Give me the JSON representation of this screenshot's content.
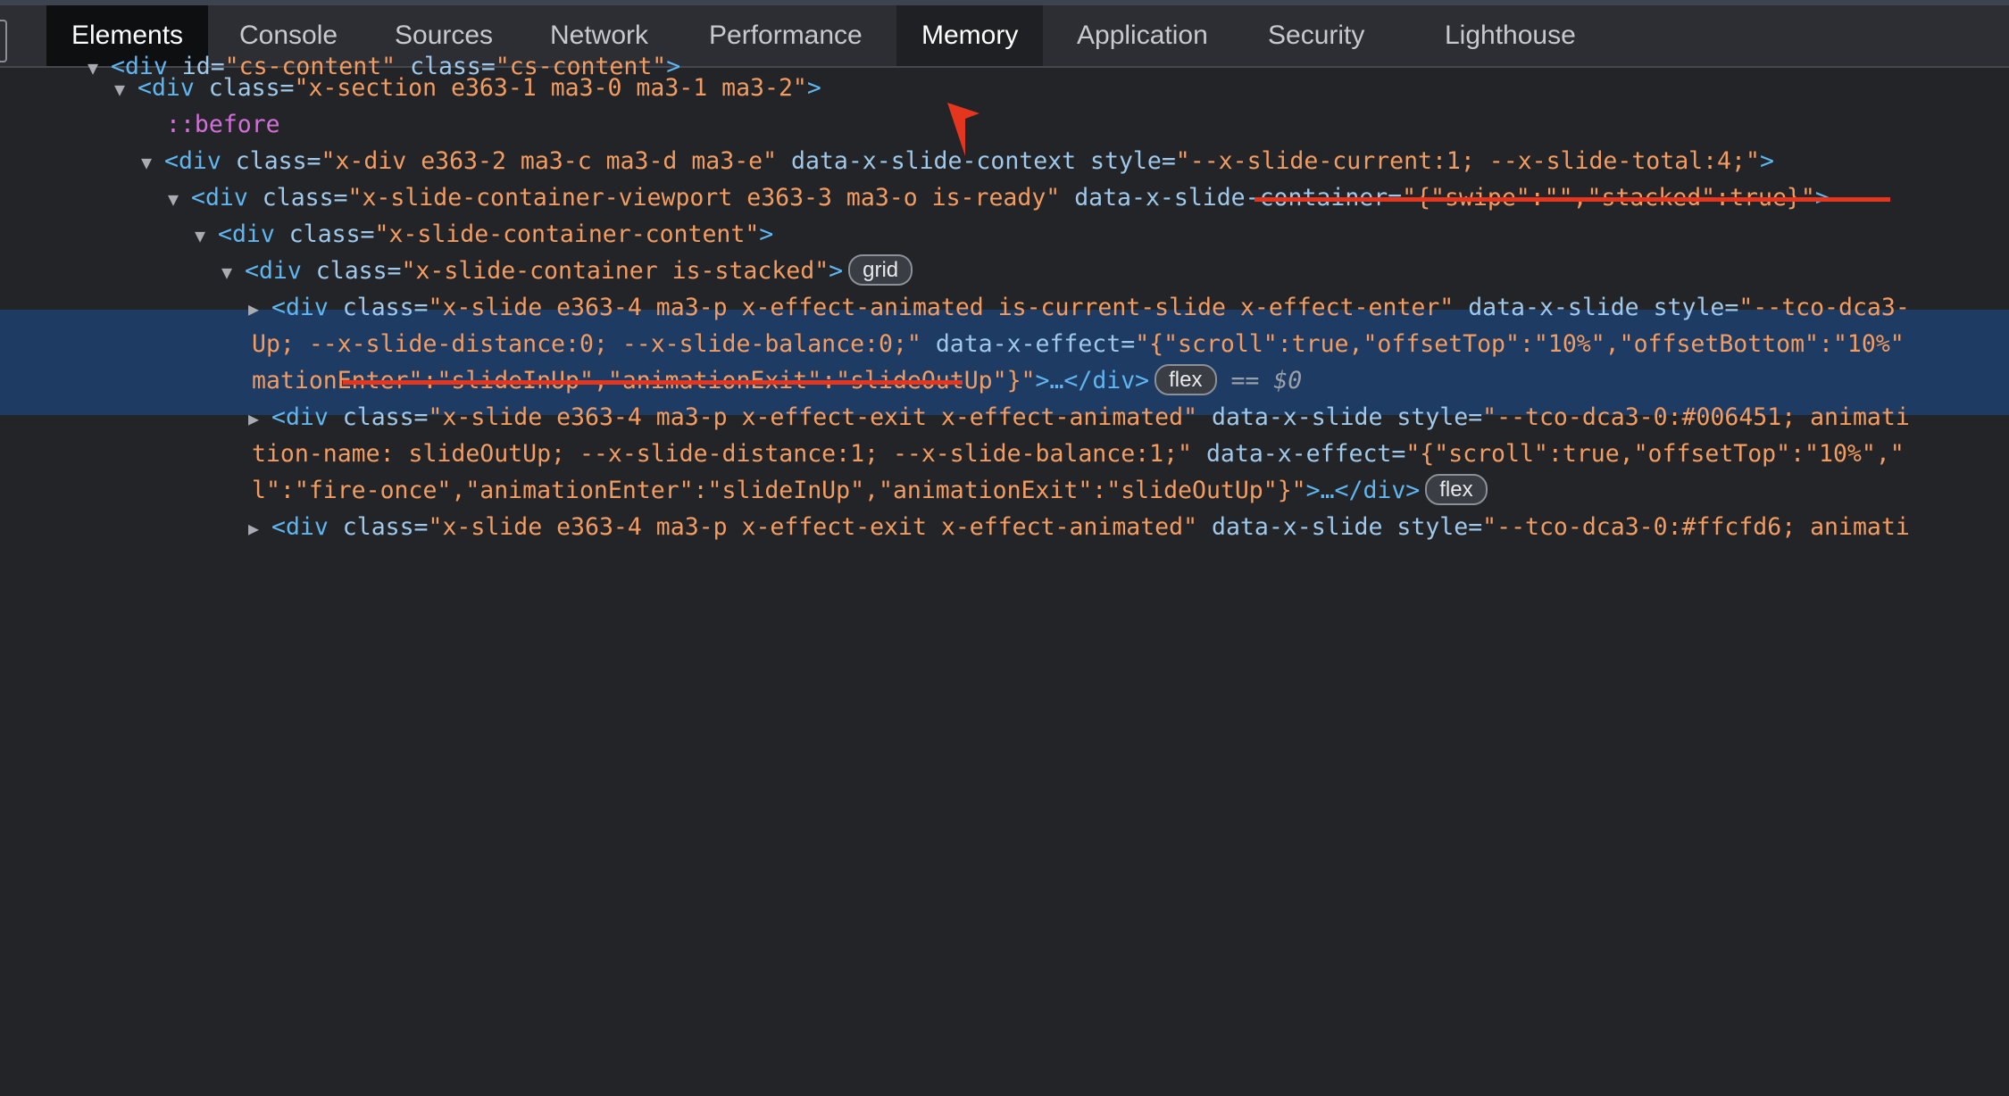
{
  "tabs": [
    {
      "label": "Elements",
      "state": "active"
    },
    {
      "label": "Console",
      "state": "normal"
    },
    {
      "label": "Sources",
      "state": "normal"
    },
    {
      "label": "Network",
      "state": "normal"
    },
    {
      "label": "Performance",
      "state": "normal"
    },
    {
      "label": "Memory",
      "state": "selected"
    },
    {
      "label": "Application",
      "state": "normal"
    },
    {
      "label": "Security",
      "state": "normal"
    },
    {
      "label": "Lighthouse",
      "state": "normal"
    }
  ],
  "tree": {
    "row0": {
      "tag": "<div",
      "a1": " id=",
      "v1": "\"cs-content\"",
      "a2": " class=",
      "v2": "\"cs-content\"",
      "end": ">"
    },
    "row1": {
      "tag": "<div",
      "a1": " class=",
      "v1": "\"x-section e363-1 ma3-0 ma3-1 ma3-2\"",
      "end": ">"
    },
    "row2": {
      "pseudo": "::before"
    },
    "row3": {
      "tag": "<div",
      "a1": " class=",
      "v1": "\"x-div e363-2 ma3-c ma3-d ma3-e\"",
      "a2": " data-x-slide-context style=",
      "v2": "\"--x-slide-current:1; --x-slide-total:4;\"",
      "end": ">"
    },
    "row4": {
      "tag": "<div",
      "a1": " class=",
      "v1": "\"x-slide-container-viewport e363-3 ma3-o is-ready\"",
      "a2": " data-x-slide-container=",
      "v2": "\"{\"swipe\":\"\",\"stacked\":true}\"",
      "end": ">"
    },
    "row5": {
      "tag": "<div",
      "a1": " class=",
      "v1": "\"x-slide-container-content\"",
      "end": ">"
    },
    "row6": {
      "tag": "<div",
      "a1": " class=",
      "v1": "\"x-slide-container is-stacked\"",
      "end": ">",
      "pill": "grid"
    },
    "row7": {
      "tag": "<div",
      "a1": " class=",
      "v1": "\"x-slide e363-4 ma3-p x-effect-animated is-current-slide x-effect-enter\"",
      "a2": " data-x-slide style=",
      "v2": "\"--tco-dca3-"
    },
    "row8": {
      "v1": "Up; --x-slide-distance:0; --x-slide-balance:0;\"",
      "a2": " data-x-effect=",
      "v2": "\"{\"scroll\":true,\"offsetTop\":\"10%\",\"offsetBottom\":\"10%\""
    },
    "row9": {
      "v1": "mationEnter\":\"slideInUp\",\"animationExit\":\"slideOutUp\"}\"",
      "end": ">…</div>",
      "pill": "flex",
      "sel": " == $0"
    },
    "row10": {
      "tag": "<div",
      "a1": " class=",
      "v1": "\"x-slide e363-4 ma3-p x-effect-exit x-effect-animated\"",
      "a2": " data-x-slide style=",
      "v2": "\"--tco-dca3-0:#006451; animati"
    },
    "row11": {
      "v1": "tion-name: slideOutUp; --x-slide-distance:1; --x-slide-balance:1;\"",
      "a2": " data-x-effect=",
      "v2": "\"{\"scroll\":true,\"offsetTop\":\"10%\",\""
    },
    "row12": {
      "v1": "l\":\"fire-once\",\"animationEnter\":\"slideInUp\",\"animationExit\":\"slideOutUp\"}\"",
      "end": ">…</div>",
      "pill": "flex"
    },
    "row13": {
      "tag": "<div",
      "a1": " class=",
      "v1": "\"x-slide e363-4 ma3-p x-effect-exit x-effect-animated\"",
      "a2": " data-x-slide style=",
      "v2": "\"--tco-dca3-0:#ffcfd6; animati"
    }
  },
  "colors": {
    "annotation_red": "#e4361f",
    "selection_bg": "#1e3b63",
    "tag_blue": "#5fb6f0",
    "value_orange": "#f29c62"
  }
}
